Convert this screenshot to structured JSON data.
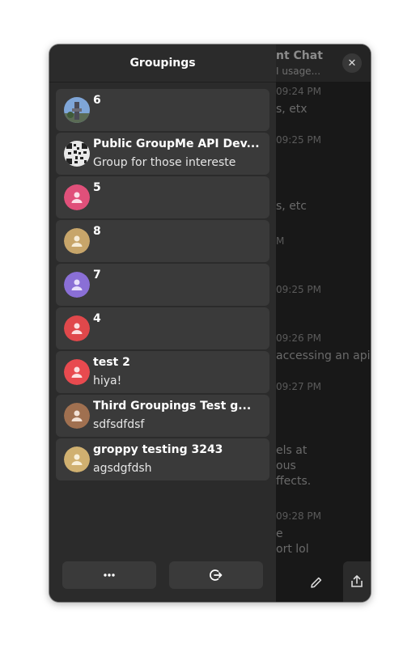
{
  "sidebar": {
    "title": "Groupings",
    "groups": [
      {
        "name": "6",
        "subtitle": "",
        "avatar": "photo"
      },
      {
        "name": "Public GroupMe API Dev...",
        "subtitle": "Group for those intereste",
        "avatar": "qr"
      },
      {
        "name": "5",
        "subtitle": "",
        "avatar": "person",
        "color": "#e0507a"
      },
      {
        "name": "8",
        "subtitle": "",
        "avatar": "person",
        "color": "#c7a56a"
      },
      {
        "name": "7",
        "subtitle": "",
        "avatar": "person",
        "color": "#8a6fd6"
      },
      {
        "name": "4",
        "subtitle": "",
        "avatar": "person",
        "color": "#e0484b"
      },
      {
        "name": "test 2",
        "subtitle": "hiya!",
        "avatar": "person",
        "color": "#e84a4f"
      },
      {
        "name": "Third Groupings Test g...",
        "subtitle": "sdfsdfdsf",
        "avatar": "person",
        "color": "#a07050"
      },
      {
        "name": "groppy testing 3243",
        "subtitle": "agsdgfdsh",
        "avatar": "person",
        "color": "#d0b070"
      }
    ],
    "more_button_icon": "more-horizontal-icon",
    "logout_button_icon": "logout-icon"
  },
  "chat": {
    "title": "nt Chat",
    "subtitle": "I usage...",
    "lines": [
      {
        "text": "09:24 PM",
        "kind": "time"
      },
      {
        "text": "s, etx",
        "kind": "msg"
      },
      {
        "text": "09:25 PM",
        "kind": "time"
      },
      {
        "text": "s, etc",
        "kind": "msg"
      },
      {
        "text": "M",
        "kind": "time"
      },
      {
        "text": "09:25 PM",
        "kind": "time"
      },
      {
        "text": "09:26 PM",
        "kind": "time"
      },
      {
        "text": "accessing an api",
        "kind": "msg"
      },
      {
        "text": "09:27 PM",
        "kind": "time"
      },
      {
        "text": "els at",
        "kind": "msg"
      },
      {
        "text": "ous",
        "kind": "msg"
      },
      {
        "text": "ffects.",
        "kind": "msg"
      },
      {
        "text": "09:28 PM",
        "kind": "time"
      },
      {
        "text": "e",
        "kind": "msg"
      },
      {
        "text": "ort lol",
        "kind": "msg"
      }
    ]
  },
  "colors": {
    "sidebar_bg": "#2b2b2b",
    "item_bg": "#3a3a3a",
    "chat_bg": "#181818"
  }
}
